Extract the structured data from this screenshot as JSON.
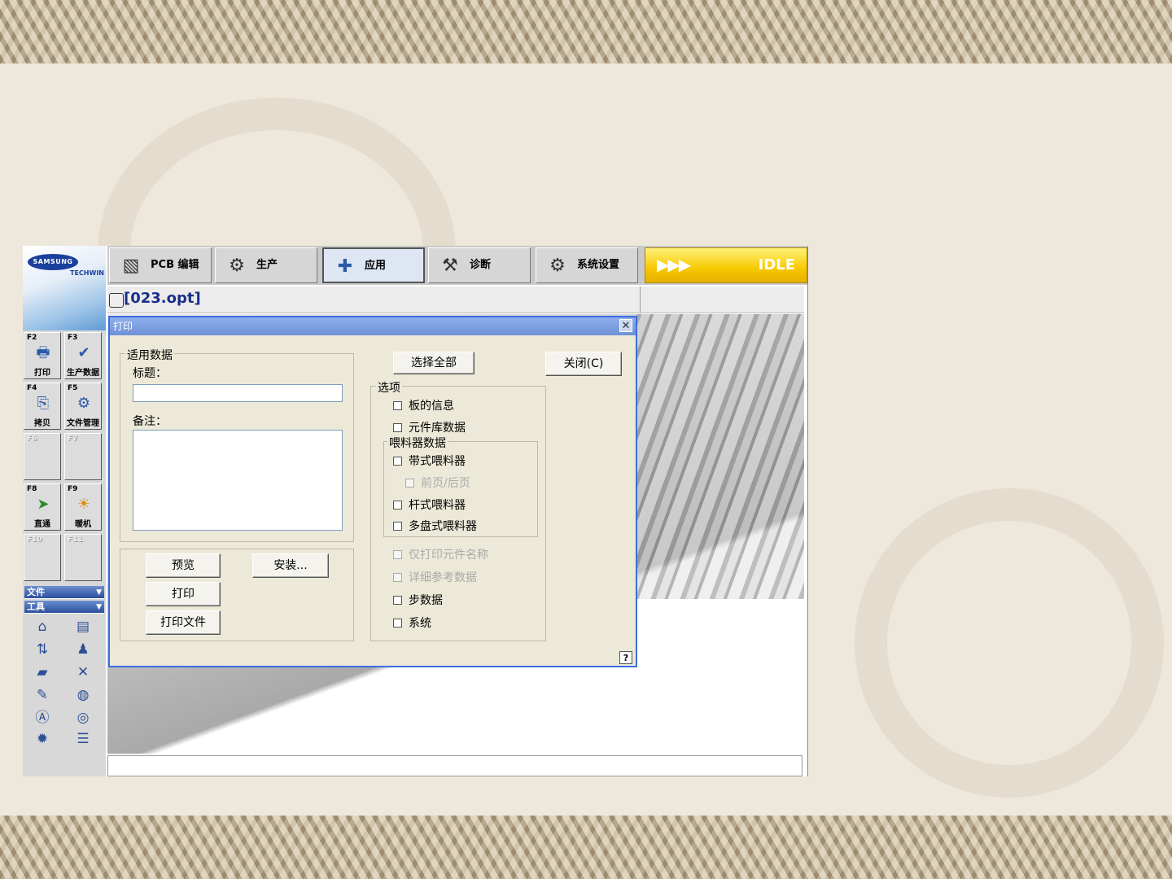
{
  "logo": {
    "brand": "SAMSUNG",
    "sub": "TECHWIN"
  },
  "toolbar": {
    "items": [
      {
        "label": "PCB 编辑",
        "icon": "pcb-edit-icon"
      },
      {
        "label": "生产",
        "icon": "production-icon"
      },
      {
        "label": "应用",
        "icon": "application-icon",
        "active": true
      },
      {
        "label": "诊断",
        "icon": "diagnosis-icon"
      },
      {
        "label": "系统设置",
        "icon": "system-settings-icon"
      }
    ],
    "status": {
      "arrows": "▶▶▶",
      "label": "IDLE",
      "color": "#f7c800"
    }
  },
  "filebar": {
    "filename": "[023.opt]"
  },
  "fkeys": [
    {
      "key": "F2",
      "label": "打印",
      "icon": "printer-icon",
      "enabled": true
    },
    {
      "key": "F3",
      "label": "生产数据",
      "icon": "production-data-icon",
      "enabled": true
    },
    {
      "key": "F4",
      "label": "拷贝",
      "icon": "copy-icon",
      "enabled": true
    },
    {
      "key": "F5",
      "label": "文件管理",
      "icon": "file-manager-icon",
      "enabled": true
    },
    {
      "key": "F6",
      "label": "",
      "enabled": false
    },
    {
      "key": "F7",
      "label": "",
      "enabled": false
    },
    {
      "key": "F8",
      "label": "直通",
      "icon": "pass-through-icon",
      "enabled": true
    },
    {
      "key": "F9",
      "label": "暖机",
      "icon": "warm-up-icon",
      "enabled": true
    },
    {
      "key": "F10",
      "label": "",
      "enabled": false
    },
    {
      "key": "F11",
      "label": "",
      "enabled": false
    }
  ],
  "menus": {
    "file": "文件",
    "tools": "工具"
  },
  "dialog": {
    "title": "打印",
    "apply_group": "适用数据",
    "title_label": "标题：",
    "title_value": "",
    "note_label": "备注：",
    "note_value": "",
    "buttons": {
      "preview": "预览",
      "setup": "安装...",
      "print": "打印",
      "print_file": "打印文件",
      "select_all": "选择全部",
      "close": "关闭(C)"
    },
    "options_group": "选项",
    "feeder_group": "喂料器数据",
    "options": {
      "board_info": {
        "label": "板的信息",
        "checked": false,
        "enabled": true
      },
      "part_lib": {
        "label": "元件库数据",
        "checked": false,
        "enabled": true
      },
      "tape_feeder": {
        "label": "带式喂料器",
        "checked": false,
        "enabled": true
      },
      "front_rear": {
        "label": "前页/后页",
        "checked": false,
        "enabled": false
      },
      "stick_feeder": {
        "label": "杆式喂料器",
        "checked": false,
        "enabled": true
      },
      "tray_feeder": {
        "label": "多盘式喂料器",
        "checked": false,
        "enabled": true
      },
      "part_name_only": {
        "label": "仅打印元件名称",
        "checked": false,
        "enabled": false
      },
      "detail_ref": {
        "label": "详细参考数据",
        "checked": false,
        "enabled": false
      },
      "step_data": {
        "label": "步数据",
        "checked": false,
        "enabled": true
      },
      "system": {
        "label": "系统",
        "checked": false,
        "enabled": true
      }
    },
    "help": "?"
  }
}
